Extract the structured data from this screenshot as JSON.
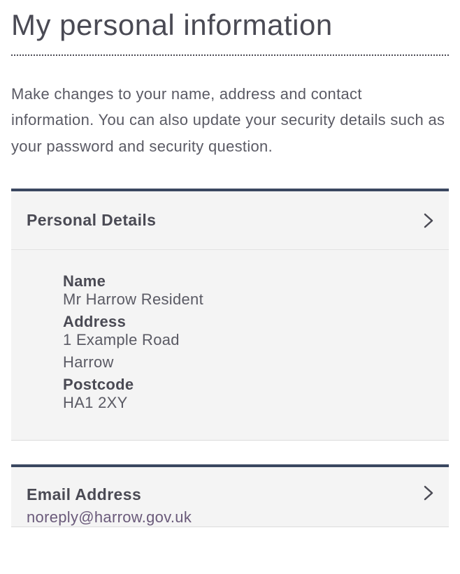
{
  "page": {
    "title": "My personal information",
    "intro": "Make changes to your name, address and contact information. You can also update your security details such as your password and security question."
  },
  "panels": {
    "personalDetails": {
      "header": "Personal Details",
      "fields": {
        "nameLabel": "Name",
        "nameValue": "Mr  Harrow  Resident",
        "addressLabel": "Address",
        "addressLine1": "1 Example Road",
        "addressLine2": "Harrow",
        "postcodeLabel": "Postcode",
        "postcodeValue": "HA1 2XY"
      }
    },
    "emailAddress": {
      "header": "Email Address",
      "value": "noreply@harrow.gov.uk"
    }
  }
}
